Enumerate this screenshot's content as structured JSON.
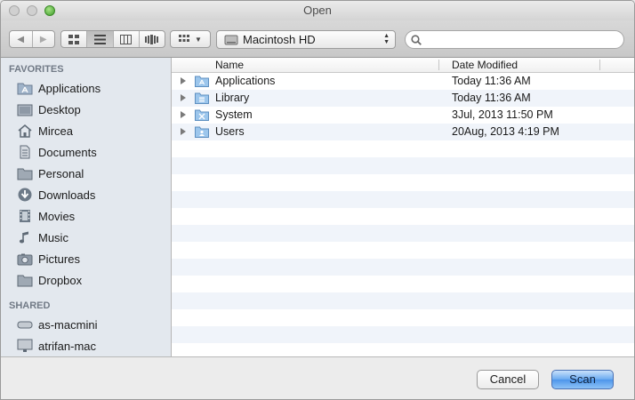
{
  "window": {
    "title": "Open"
  },
  "toolbar": {
    "location": "Macintosh HD",
    "search_placeholder": ""
  },
  "sidebar": {
    "favorites_header": "FAVORITES",
    "favorites": [
      {
        "label": "Applications",
        "icon": "applications-icon"
      },
      {
        "label": "Desktop",
        "icon": "desktop-icon"
      },
      {
        "label": "Mircea",
        "icon": "home-icon"
      },
      {
        "label": "Documents",
        "icon": "documents-icon"
      },
      {
        "label": "Personal",
        "icon": "folder-icon"
      },
      {
        "label": "Downloads",
        "icon": "downloads-icon"
      },
      {
        "label": "Movies",
        "icon": "movies-icon"
      },
      {
        "label": "Music",
        "icon": "music-icon"
      },
      {
        "label": "Pictures",
        "icon": "pictures-icon"
      },
      {
        "label": "Dropbox",
        "icon": "folder-icon"
      }
    ],
    "shared_header": "SHARED",
    "shared": [
      {
        "label": "as-macmini",
        "icon": "server-icon"
      },
      {
        "label": "atrifan-mac",
        "icon": "imac-icon"
      }
    ]
  },
  "table": {
    "col_name": "Name",
    "col_date": "Date Modified",
    "rows": [
      {
        "name": "Applications",
        "date": "Today 11:36 AM"
      },
      {
        "name": "Library",
        "date": "Today 11:36 AM"
      },
      {
        "name": "System",
        "date": "3Jul, 2013 11:50 PM"
      },
      {
        "name": "Users",
        "date": "20Aug, 2013 4:19 PM"
      }
    ]
  },
  "footer": {
    "cancel_label": "Cancel",
    "scan_label": "Scan"
  }
}
